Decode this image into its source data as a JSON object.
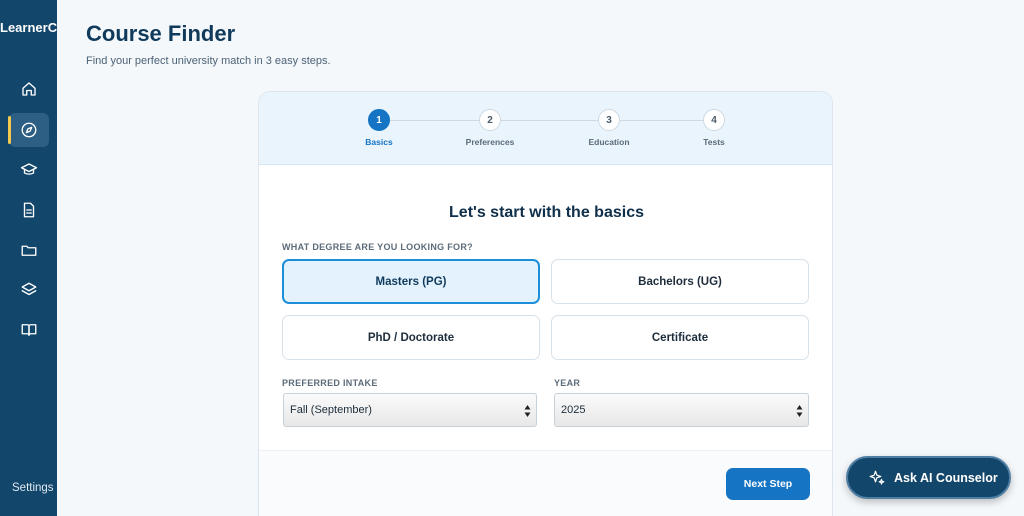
{
  "app": {
    "brand": "LearnerCo"
  },
  "sidebar": {
    "items": [
      {
        "icon": "home-icon"
      },
      {
        "icon": "compass-icon",
        "active": true
      },
      {
        "icon": "graduation-cap-icon"
      },
      {
        "icon": "document-icon"
      },
      {
        "icon": "folder-icon"
      },
      {
        "icon": "layers-icon"
      },
      {
        "icon": "book-icon"
      }
    ],
    "settings_label": "Settings"
  },
  "header": {
    "title": "Course Finder",
    "subtitle": "Find your perfect university match in 3 easy steps."
  },
  "stepper": {
    "steps": [
      {
        "number": "1",
        "label": "Basics",
        "active": true
      },
      {
        "number": "2",
        "label": "Preferences"
      },
      {
        "number": "3",
        "label": "Education"
      },
      {
        "number": "4",
        "label": "Tests"
      }
    ]
  },
  "form": {
    "title": "Let's start with the basics",
    "degree_label": "WHAT DEGREE ARE YOU LOOKING FOR?",
    "degree_options": [
      {
        "label": "Masters (PG)",
        "selected": true
      },
      {
        "label": "Bachelors (UG)"
      },
      {
        "label": "PhD / Doctorate"
      },
      {
        "label": "Certificate"
      }
    ],
    "intake_label": "PREFERRED INTAKE",
    "intake_value": "Fall (September)",
    "year_label": "YEAR",
    "year_value": "2025",
    "next_label": "Next Step"
  },
  "ai_counselor": {
    "label": "Ask AI Counselor",
    "icon": "sparkles-icon"
  },
  "colors": {
    "sidebar": "#13466b",
    "accent": "#1574c4",
    "selected_bg": "#e3f2fd",
    "active_marker": "#f2c94c"
  }
}
